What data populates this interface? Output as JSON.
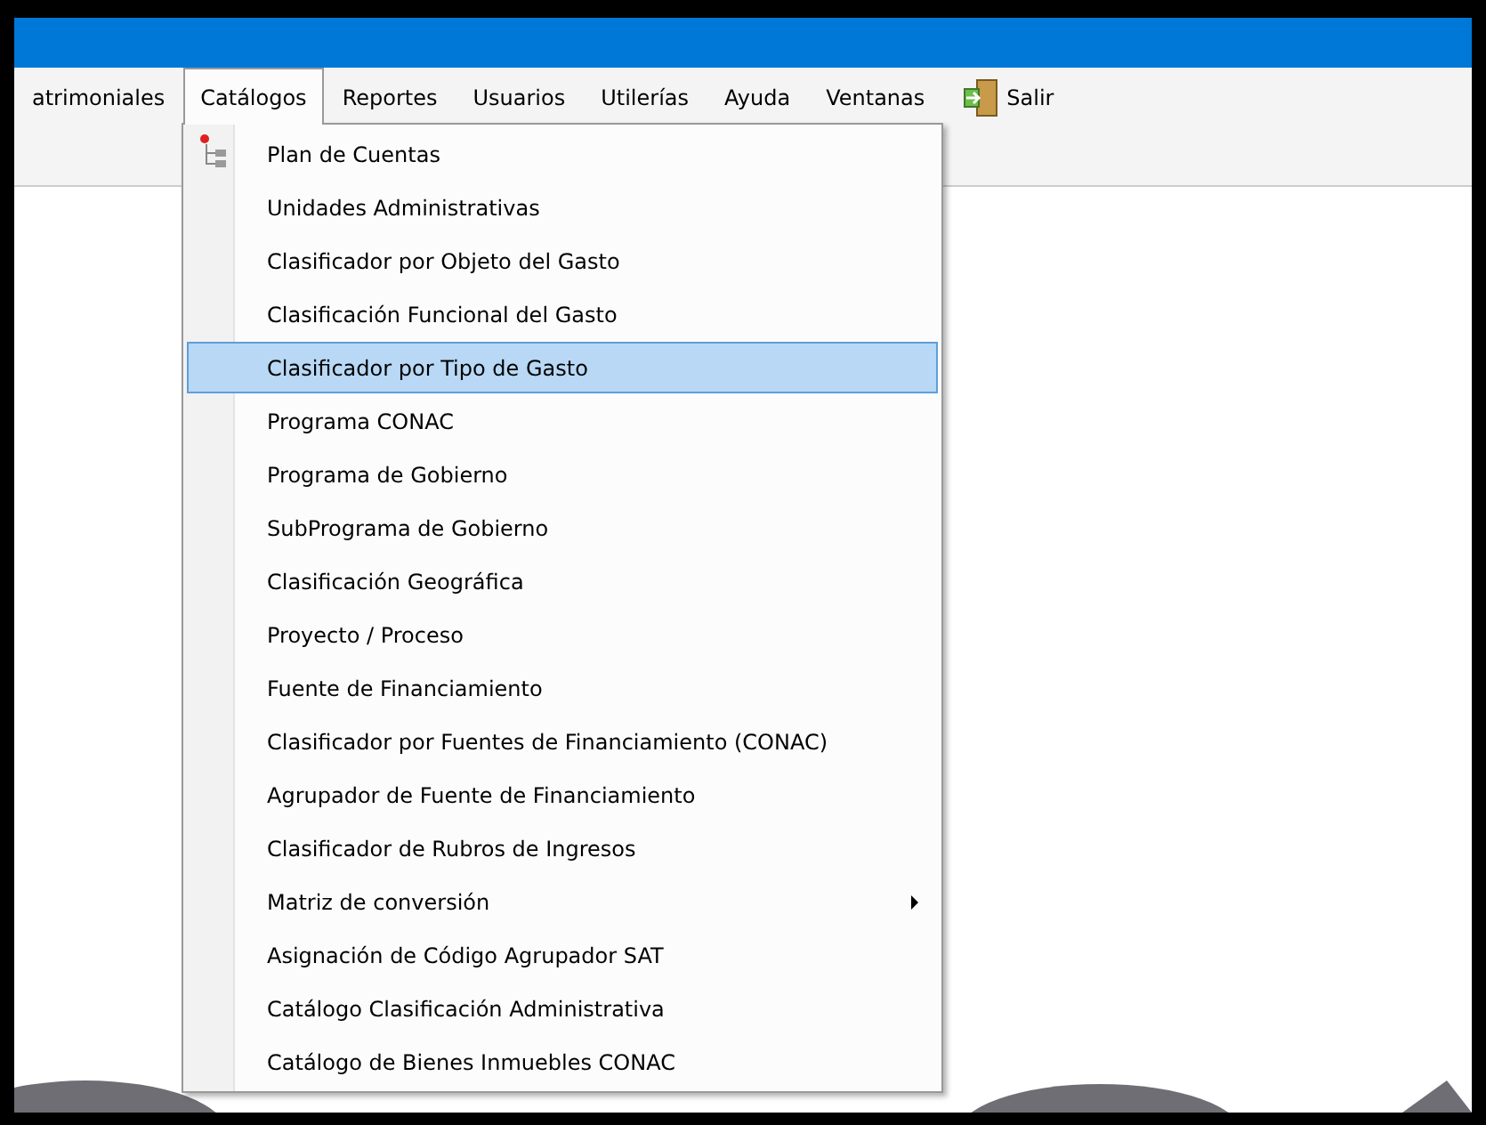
{
  "menu_bar": [
    {
      "label": "atrimoniales",
      "kind": "text",
      "selected": false
    },
    {
      "label": "Catálogos",
      "kind": "text",
      "selected": true
    },
    {
      "label": "Reportes",
      "kind": "text",
      "selected": false
    },
    {
      "label": "Usuarios",
      "kind": "text",
      "selected": false
    },
    {
      "label": "Utilerías",
      "kind": "text",
      "selected": false
    },
    {
      "label": "Ayuda",
      "kind": "text",
      "selected": false
    },
    {
      "label": "Ventanas",
      "kind": "text",
      "selected": false
    },
    {
      "label": "Salir",
      "kind": "exit",
      "selected": false
    }
  ],
  "dropdown": [
    {
      "label": "Plan de Cuentas",
      "kind": "tree",
      "selected": false
    },
    {
      "label": "Unidades Administrativas",
      "kind": "item",
      "selected": false
    },
    {
      "label": "Clasificador por Objeto del Gasto",
      "kind": "item",
      "selected": false
    },
    {
      "label": "Clasificación Funcional del Gasto",
      "kind": "item",
      "selected": false
    },
    {
      "label": "Clasificador por Tipo de Gasto",
      "kind": "item",
      "selected": true
    },
    {
      "label": "Programa CONAC",
      "kind": "item",
      "selected": false
    },
    {
      "label": "Programa de Gobierno",
      "kind": "item",
      "selected": false
    },
    {
      "label": "SubPrograma de Gobierno",
      "kind": "item",
      "selected": false
    },
    {
      "label": "Clasificación Geográfica",
      "kind": "item",
      "selected": false
    },
    {
      "label": "Proyecto / Proceso",
      "kind": "item",
      "selected": false
    },
    {
      "label": "Fuente de Financiamiento",
      "kind": "item",
      "selected": false
    },
    {
      "label": "Clasificador por Fuentes de Financiamiento (CONAC)",
      "kind": "item",
      "selected": false
    },
    {
      "label": "Agrupador de Fuente de Financiamiento",
      "kind": "item",
      "selected": false
    },
    {
      "label": "Clasificador de Rubros de Ingresos",
      "kind": "item",
      "selected": false
    },
    {
      "label": "Matriz de conversión",
      "kind": "submenu",
      "selected": false
    },
    {
      "label": "Asignación de Código Agrupador SAT",
      "kind": "item",
      "selected": false
    },
    {
      "label": "Catálogo Clasificación Administrativa",
      "kind": "item",
      "selected": false
    },
    {
      "label": "Catálogo de Bienes Inmuebles CONAC",
      "kind": "item",
      "selected": false
    }
  ]
}
